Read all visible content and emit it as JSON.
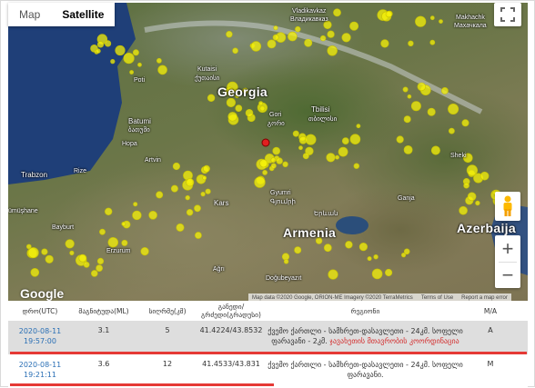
{
  "map": {
    "type_buttons": [
      "Map",
      "Satellite"
    ],
    "active_type": "Satellite",
    "labels": {
      "georgia": "Georgia",
      "armenia": "Armenia",
      "azerbaijan": "Azerbaija",
      "tbilisi": "Tbilisi",
      "tbilisi_local": "თბილისი",
      "kutaisi": "Kutaisi",
      "kutaisi_local": "ქუთაისი",
      "batumi": "Batumi",
      "batumi_local": "ბათუმი",
      "vladikavkaz": "Vladikavkaz",
      "vladikavkaz_local": "Владикавказ",
      "makhachkala": "Makhachk",
      "makhachkala_local": "Махачкала",
      "gori": "Gori",
      "gori_local": "გორი",
      "gyumri": "Gyumri",
      "gyumri_local": "Գյումրի",
      "yerevan_local": "Երևան",
      "ganja": "Ganja",
      "trabzon": "Trabzon",
      "rize": "Rize",
      "hopa": "Hopa",
      "artvin": "Artvin",
      "kars": "Kars",
      "bayburt": "Bayburt",
      "erzurum": "Erzurum",
      "agri": "Ağrı",
      "dogubeyazit": "Doğubeyazıt",
      "poti": "Poti",
      "sheki": "Sheki",
      "gumushane": "ümüşhane"
    },
    "google_logo": "Google",
    "attribution": [
      "Map data ©2020 Google, ORION-ME Imagery ©2020 TerraMetrics",
      "Terms of Use",
      "Report a map error"
    ]
  },
  "table": {
    "headers": [
      "დრო(UTC)",
      "მაგნიტუდა(ML)",
      "სიღრმე(კმ)",
      "განედი/გრძედი(გრადუსი)",
      "რეგიონი",
      "M/A"
    ],
    "rows": [
      {
        "date": "2020-08-11",
        "time": "19:57:00",
        "magnitude": "3.1",
        "depth": "5",
        "coords": "41.4224/43.8532",
        "region_line1": "ქვემო ქართლი - სამხრეთ-დასავლეთი - 24კმ. სოფელი",
        "region_line2_a": "ფარავანი - 2კმ.",
        "region_line2_b": "ჯავახეთის მთავრობის კოორდინაცია",
        "ma": "A"
      },
      {
        "date": "2020-08-11",
        "time": "19:21:11",
        "magnitude": "3.6",
        "depth": "12",
        "coords": "41.4533/43.831",
        "region_line1": "ქვემო ქართლი - სამხრეთ-დასავლეთი - 24კმ. სოფელი",
        "region_line2_a": "ფარავანი.",
        "ma": "M"
      }
    ]
  },
  "colors": {
    "quake_dot": "#f5f20a",
    "quake_dot_stroke": "#c7c100",
    "recent_dot": "#e02020",
    "link": "#2a6fb5",
    "highlight_row": "#dedede",
    "underline": "#e53935"
  },
  "icons": {
    "fullscreen": "fullscreen-icon",
    "pegman": "pegman-icon",
    "zoom_in": "zoom-in-icon",
    "zoom_out": "zoom-out-icon"
  }
}
